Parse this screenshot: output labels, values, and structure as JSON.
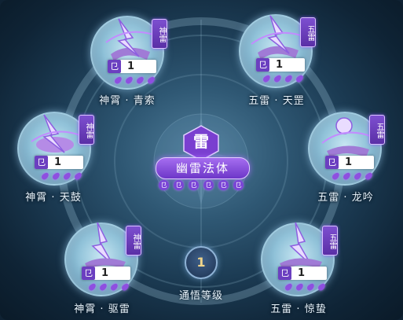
{
  "center": {
    "element": "雷",
    "title": "幽雷法体",
    "icons": [
      "⺋",
      "⺋",
      "⺋",
      "⺋",
      "⺋",
      "⺋"
    ]
  },
  "level": {
    "value": "1",
    "label": "通悟等级"
  },
  "nodes": [
    {
      "badge": "神雷",
      "level": "1",
      "name": "神霄 · 青索",
      "level_icon": "⺋",
      "drops": 4
    },
    {
      "badge": "五雷",
      "level": "1",
      "name": "五雷 · 天罡",
      "level_icon": "⺋",
      "drops": 4
    },
    {
      "badge": "神雷",
      "level": "1",
      "name": "神霄 · 天鼓",
      "level_icon": "⺋",
      "drops": 4
    },
    {
      "badge": "五雷",
      "level": "1",
      "name": "五雷 · 龙吟",
      "level_icon": "⺋",
      "drops": 4
    },
    {
      "badge": "神雷",
      "level": "1",
      "name": "神霄 · 驱雷",
      "level_icon": "⺋",
      "drops": 4
    },
    {
      "badge": "五雷",
      "level": "1",
      "name": "五雷 · 惊蛰",
      "level_icon": "⺋",
      "drops": 4
    }
  ],
  "colors": {
    "accent": "#7d4fd0",
    "level_number": "#f0d48a",
    "label_text": "#e8f3fb"
  }
}
